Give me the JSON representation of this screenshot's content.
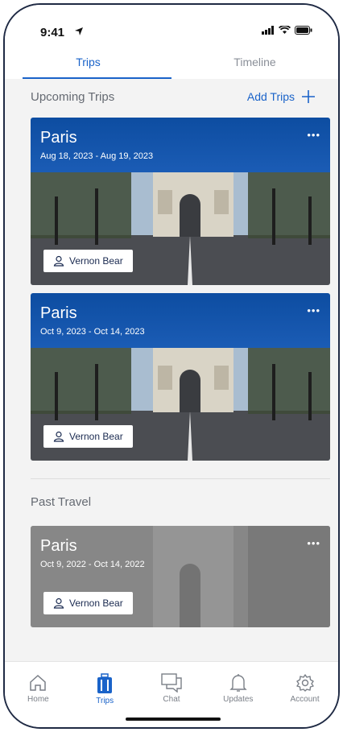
{
  "status": {
    "time": "9:41"
  },
  "tabs": [
    {
      "label": "Trips",
      "active": true
    },
    {
      "label": "Timeline",
      "active": false
    }
  ],
  "upcoming": {
    "title": "Upcoming Trips",
    "add_label": "Add Trips",
    "trips": [
      {
        "city": "Paris",
        "dates": "Aug 18, 2023 - Aug 19, 2023",
        "traveler": "Vernon Bear"
      },
      {
        "city": "Paris",
        "dates": "Oct 9, 2023 - Oct 14, 2023",
        "traveler": "Vernon Bear"
      }
    ]
  },
  "past": {
    "title": "Past Travel",
    "trips": [
      {
        "city": "Paris",
        "dates": "Oct 9, 2022 - Oct 14, 2022",
        "traveler": "Vernon Bear"
      }
    ]
  },
  "nav": [
    {
      "label": "Home",
      "icon": "home-icon"
    },
    {
      "label": "Trips",
      "icon": "suitcase-icon",
      "active": true
    },
    {
      "label": "Chat",
      "icon": "chat-icon"
    },
    {
      "label": "Updates",
      "icon": "bell-icon"
    },
    {
      "label": "Account",
      "icon": "gear-icon"
    }
  ],
  "colors": {
    "accent": "#1a63c9",
    "card_blue": "#0d4da1",
    "past_gray": "#7a7a7a"
  }
}
